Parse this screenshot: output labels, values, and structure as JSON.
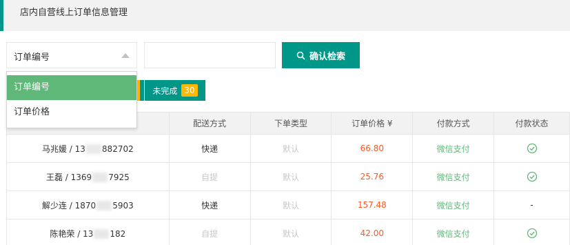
{
  "header": {
    "title": "店内自营线上订单信息管理"
  },
  "search": {
    "selected": "订单编号",
    "options": [
      "订单编号",
      "订单价格"
    ],
    "input_value": "",
    "button_label": "确认检索"
  },
  "status_filter": {
    "label": "未完成",
    "count": "30"
  },
  "table": {
    "headers": [
      "",
      "配送方式",
      "下单类型",
      "订单价格 ¥",
      "付款方式",
      "付款状态"
    ],
    "rows": [
      {
        "user_a": "马兆媛 / 13",
        "user_b": "882702",
        "ship": "快递",
        "type": "默认",
        "price": "66.80",
        "pay": "微信支付",
        "status": "check",
        "status_text": ""
      },
      {
        "user_a": "王磊 / 1369",
        "user_b": "7925",
        "ship": "自提",
        "type": "默认",
        "price": "25.76",
        "pay": "微信支付",
        "status": "check",
        "status_text": ""
      },
      {
        "user_a": "解少连 / 1870",
        "user_b": "5903",
        "ship": "快递",
        "type": "默认",
        "price": "157.48",
        "pay": "微信支付",
        "status": "none",
        "status_text": "-"
      },
      {
        "user_a": "陈艳荣 / 13",
        "user_b": "182",
        "ship": "自提",
        "type": "默认",
        "price": "42.00",
        "pay": "微信支付",
        "status": "check",
        "status_text": ""
      }
    ]
  },
  "colors": {
    "accent": "#009688",
    "active_option": "#5fb878",
    "badge": "#ffb800",
    "price": "#ff5722",
    "pay": "#5fb878"
  },
  "icons": {
    "search": "search-icon",
    "caret": "caret-up-icon",
    "status": "check-circle-icon"
  }
}
